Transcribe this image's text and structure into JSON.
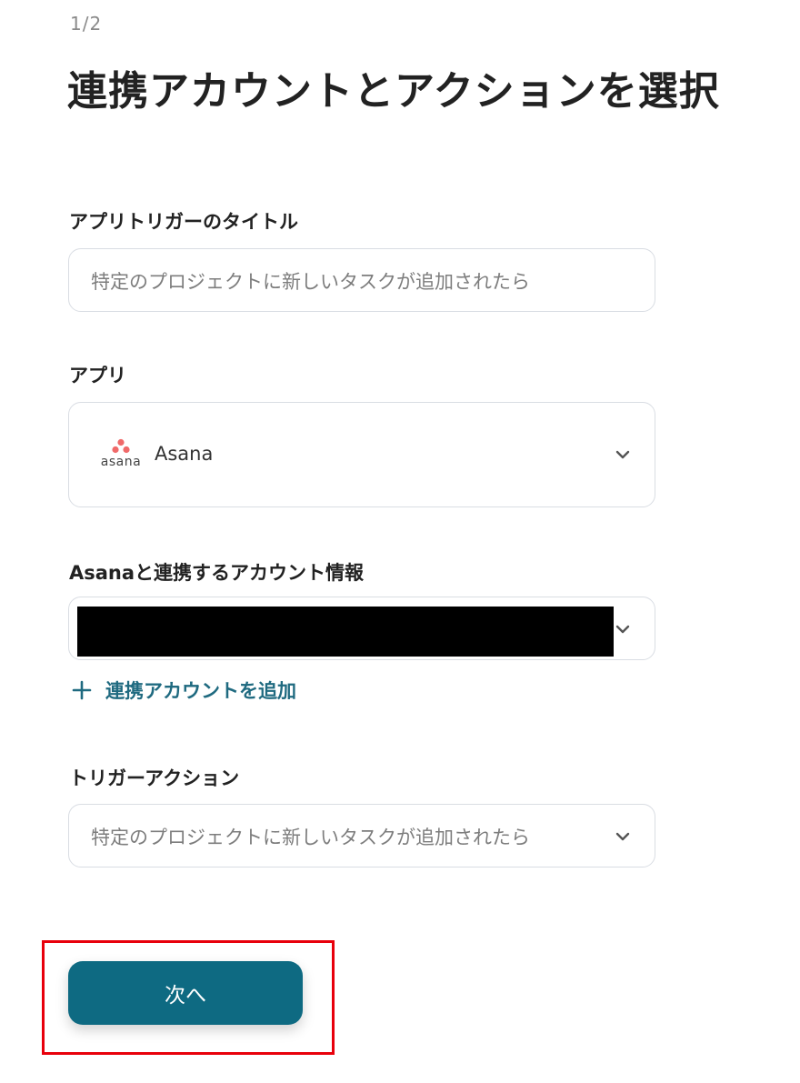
{
  "step": "1/2",
  "page_title": "連携アカウントとアクションを選択",
  "fields": {
    "trigger_title": {
      "label": "アプリトリガーのタイトル",
      "value": "特定のプロジェクトに新しいタスクが追加されたら"
    },
    "app": {
      "label": "アプリ",
      "logo_wordmark": "asana",
      "value": "Asana",
      "icon": "chevron-down-icon"
    },
    "account": {
      "label": "Asanaと連携するアカウント情報",
      "value": "",
      "icon": "chevron-down-icon"
    },
    "add_account": {
      "icon": "plus-icon",
      "label": "連携アカウントを追加"
    },
    "trigger_action": {
      "label": "トリガーアクション",
      "value": "特定のプロジェクトに新しいタスクが追加されたら",
      "icon": "chevron-down-icon"
    }
  },
  "next_button": {
    "label": "次へ"
  },
  "colors": {
    "primary": "#0e6a82",
    "link": "#1f6a80",
    "highlight": "#e8000b",
    "asana_logo": "#f06a6a",
    "field_border": "#d9dde3"
  }
}
